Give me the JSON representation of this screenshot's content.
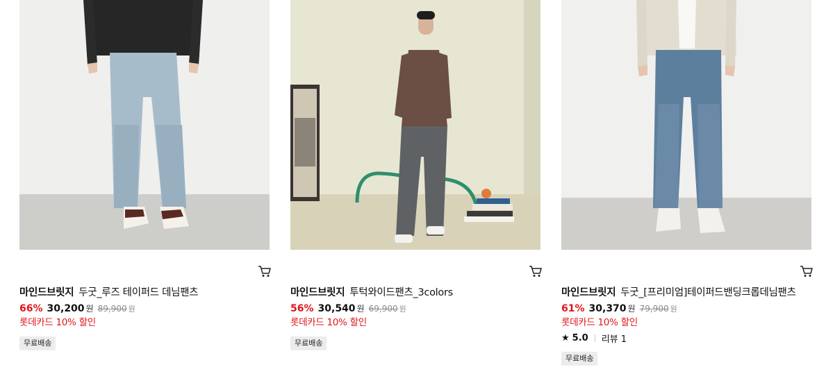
{
  "products": [
    {
      "brand": "마인드브릿지",
      "name": "두굿_루즈 테이퍼드 데님팬츠",
      "discount": "66%",
      "price": "30,200",
      "price_unit": "원",
      "original_price": "89,900",
      "original_unit": "원",
      "card_discount": "롯데카드 10% 할인",
      "badge": "무료배송"
    },
    {
      "brand": "마인드브릿지",
      "name": "투턱와이드팬츠_3colors",
      "discount": "56%",
      "price": "30,540",
      "price_unit": "원",
      "original_price": "69,900",
      "original_unit": "원",
      "card_discount": "롯데카드 10% 할인",
      "badge": "무료배송"
    },
    {
      "brand": "마인드브릿지",
      "name": "두굿_[프리미엄]테이퍼드밴딩크롭데님팬츠",
      "discount": "61%",
      "price": "30,370",
      "price_unit": "원",
      "original_price": "79,900",
      "original_unit": "원",
      "card_discount": "롯데카드 10% 할인",
      "rating": "5.0",
      "review": "리뷰 1",
      "badge": "무료배송"
    }
  ],
  "icons": {
    "cart": "cart-icon",
    "star": "star-icon"
  },
  "colors": {
    "discount": "#e0161b",
    "badge_bg": "#ececec"
  }
}
